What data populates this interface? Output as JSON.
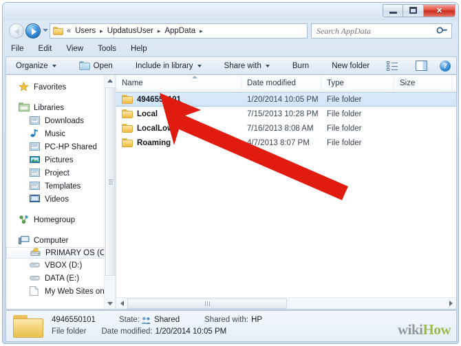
{
  "window": {
    "title": "",
    "controls": {
      "minimize": "minimize-button",
      "maximize": "maximize-button",
      "close": "✕"
    }
  },
  "address_bar": {
    "overflow_chevrons": "«",
    "crumbs": [
      "Users",
      "UpdatusUser",
      "AppData"
    ],
    "separator": "▸",
    "refresh_label": "↻"
  },
  "search": {
    "placeholder": "Search AppData",
    "value": "",
    "icon": "search-icon"
  },
  "menubar": {
    "items": [
      "File",
      "Edit",
      "View",
      "Tools",
      "Help"
    ]
  },
  "toolbar": {
    "organize": "Organize",
    "open": "Open",
    "include_in_library": "Include in library",
    "share_with": "Share with",
    "burn": "Burn",
    "new_folder": "New folder",
    "views_icon": "views-icon",
    "preview_pane_icon": "preview-pane-icon",
    "help_icon": "help-icon",
    "help_glyph": "?"
  },
  "sidebar": {
    "groups": [
      {
        "label": "Favorites",
        "icon": "star-icon",
        "level": 0,
        "selected": false
      },
      {
        "label": "Libraries",
        "icon": "libraries-icon",
        "level": 0,
        "selected": false
      },
      {
        "label": "Downloads",
        "icon": "library-folder-icon",
        "level": 1,
        "selected": false
      },
      {
        "label": "Music",
        "icon": "music-note-icon",
        "level": 1,
        "selected": false
      },
      {
        "label": "PC-HP Shared",
        "icon": "library-folder-icon",
        "level": 1,
        "selected": false
      },
      {
        "label": "Pictures",
        "icon": "pictures-icon",
        "level": 1,
        "selected": false
      },
      {
        "label": "Project",
        "icon": "library-folder-icon",
        "level": 1,
        "selected": false
      },
      {
        "label": "Templates",
        "icon": "library-folder-icon",
        "level": 1,
        "selected": false
      },
      {
        "label": "Videos",
        "icon": "videos-icon",
        "level": 1,
        "selected": false
      },
      {
        "label": "Homegroup",
        "icon": "homegroup-icon",
        "level": 0,
        "selected": false
      },
      {
        "label": "Computer",
        "icon": "computer-icon",
        "level": 0,
        "selected": false
      },
      {
        "label": "PRIMARY OS (C:)",
        "icon": "os-drive-icon",
        "level": 1,
        "selected": true
      },
      {
        "label": "VBOX (D:)",
        "icon": "drive-icon",
        "level": 1,
        "selected": false
      },
      {
        "label": "DATA (E:)",
        "icon": "drive-icon",
        "level": 1,
        "selected": false
      },
      {
        "label": "My Web Sites on MSN",
        "icon": "page-icon",
        "level": 1,
        "selected": false
      }
    ]
  },
  "file_list": {
    "columns": [
      {
        "key": "name",
        "label": "Name",
        "sorted": true,
        "sort_dir": "asc"
      },
      {
        "key": "date",
        "label": "Date modified",
        "sorted": false
      },
      {
        "key": "type",
        "label": "Type",
        "sorted": false
      },
      {
        "key": "size",
        "label": "Size",
        "sorted": false
      }
    ],
    "rows": [
      {
        "name": "4946550101",
        "date": "1/20/2014 10:05 PM",
        "type": "File folder",
        "size": "",
        "selected": true,
        "icon": "folder-icon"
      },
      {
        "name": "Local",
        "date": "7/15/2013 10:28 PM",
        "type": "File folder",
        "size": "",
        "selected": false,
        "icon": "folder-icon"
      },
      {
        "name": "LocalLow",
        "date": "7/16/2013 8:08 AM",
        "type": "File folder",
        "size": "",
        "selected": false,
        "icon": "folder-icon"
      },
      {
        "name": "Roaming",
        "date": "4/7/2013 8:07 PM",
        "type": "File folder",
        "size": "",
        "selected": false,
        "icon": "folder-icon"
      }
    ]
  },
  "status_bar": {
    "item_name": "4946550101",
    "item_type": "File folder",
    "state_label": "State:",
    "state_value": "Shared",
    "shared_with_label": "Shared with:",
    "shared_with_value": "HP",
    "date_label": "Date modified:",
    "date_value": "1/20/2014 10:05 PM",
    "icon": "large-folder-icon"
  },
  "watermark": {
    "part1": "wiki",
    "part2": "How"
  },
  "annotation": {
    "arrow_color": "#e01b10",
    "arrow_name": "red-pointer-arrow"
  },
  "colors": {
    "selection_blue": "#cfe4f8",
    "folder_yellow": "#f7cf6b",
    "accent_red": "#e01b10",
    "watermark_green": "#93b83f"
  }
}
